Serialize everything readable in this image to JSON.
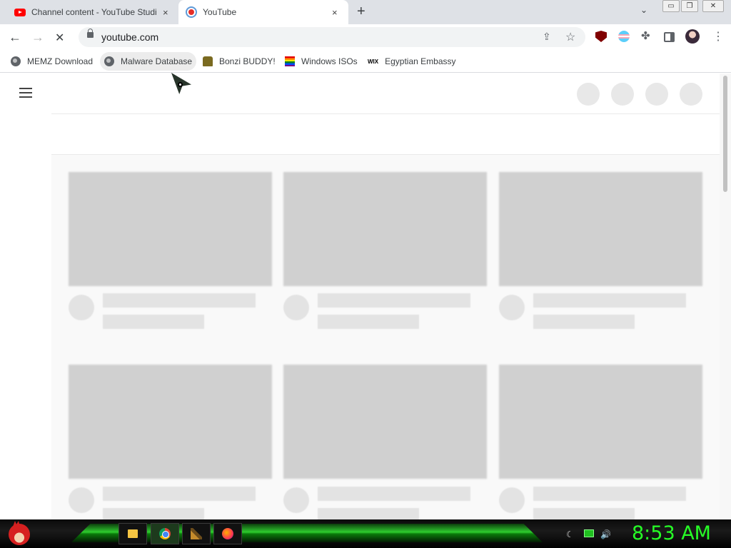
{
  "browser": {
    "tabs": [
      {
        "title": "Channel content - YouTube Studio",
        "active": false
      },
      {
        "title": "YouTube",
        "active": true
      }
    ],
    "close_glyph": "×",
    "new_tab_glyph": "+",
    "tab_search_glyph": "⌄",
    "window_controls": {
      "minimize": "▭",
      "restore": "❐",
      "close": "✕"
    },
    "nav": {
      "back": "←",
      "forward": "→",
      "reload": "✕"
    },
    "address": "youtube.com",
    "omnibox_icons": {
      "share": "⇪",
      "bookmark_star": "☆"
    },
    "extension_icons": [
      "ublock-origin-icon",
      "trans-flag-icon",
      "puzzle-icon",
      "side-panel-icon",
      "profile-avatar-icon"
    ],
    "menu_glyph": "⋮",
    "puzzle_glyph": "✤",
    "bookmarks": [
      {
        "label": "MEMZ Download",
        "icon": "globe-icon"
      },
      {
        "label": "Malware Database",
        "icon": "globe-icon"
      },
      {
        "label": "Bonzi BUDDY!",
        "icon": "bonzi-icon"
      },
      {
        "label": "Windows ISOs",
        "icon": "rainbow-flag-icon"
      },
      {
        "label": "Egyptian Embassy",
        "icon": "wix-icon"
      }
    ],
    "wix_text": "WIX"
  },
  "youtube": {
    "state": "loading-skeleton",
    "placeholder_rows": 2,
    "placeholder_columns": 3
  },
  "taskbar": {
    "apps": [
      "folder-icon",
      "chrome-icon",
      "paint-icon",
      "firefox-icon"
    ],
    "tray": {
      "left_glyph": "☾",
      "volume_glyph": "🔊"
    },
    "clock": "8:53 AM"
  },
  "colors": {
    "accent_clock": "#26ff26",
    "taskbar_green": "#2ecc2e",
    "youtube_red": "#ff0000",
    "skeleton_gray": "#d0d0d0"
  }
}
